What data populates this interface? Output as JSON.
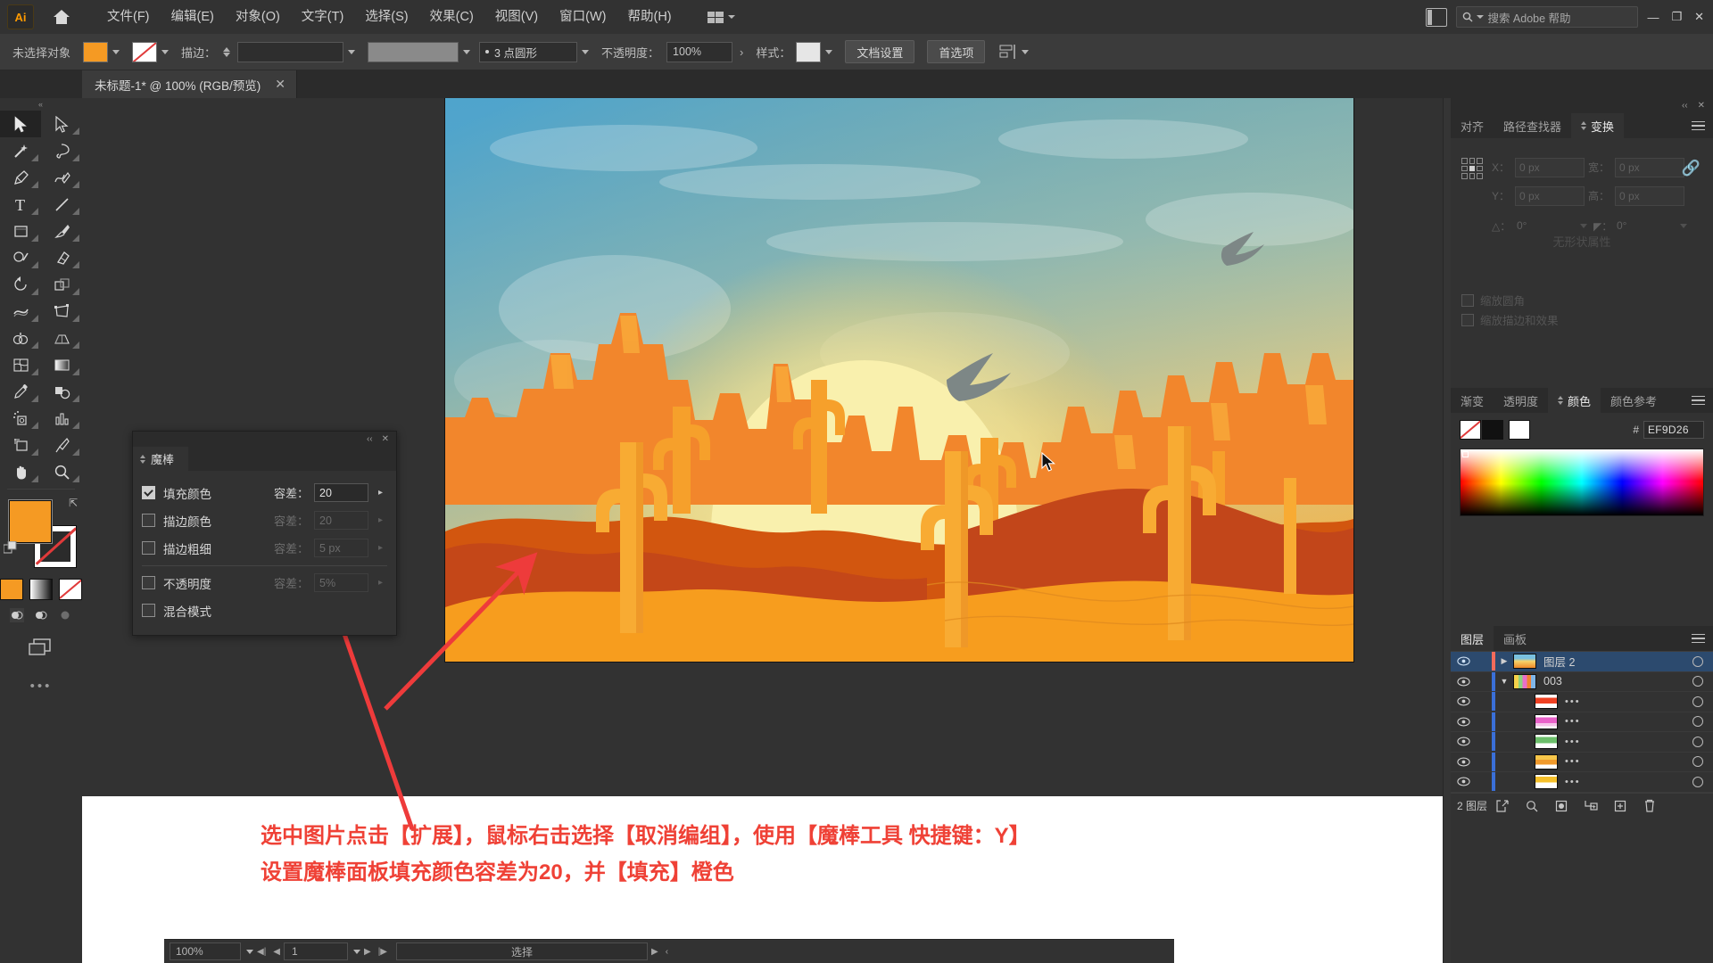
{
  "app": {
    "name": "Adobe Illustrator",
    "logo_text": "Ai",
    "home_icon": "home-icon",
    "search_placeholder": "搜索 Adobe 帮助",
    "search_icon": "search-icon",
    "panel_toggle_icon": "panel-layout-icon",
    "win_minimize": "—",
    "win_restore": "❐",
    "win_close": "✕"
  },
  "menu": {
    "items": [
      {
        "label": "文件(F)"
      },
      {
        "label": "编辑(E)"
      },
      {
        "label": "对象(O)"
      },
      {
        "label": "文字(T)"
      },
      {
        "label": "选择(S)"
      },
      {
        "label": "效果(C)"
      },
      {
        "label": "视图(V)"
      },
      {
        "label": "窗口(W)"
      },
      {
        "label": "帮助(H)"
      }
    ],
    "workspace_switcher": "workspace-switcher"
  },
  "control_bar": {
    "selection_status": "未选择对象",
    "fill_label": "fill-swatch",
    "stroke_label": "stroke-swatch",
    "stroke_text": "描边：",
    "stroke_weight_value": "",
    "brush_value": "",
    "stroke_profile": "3 点圆形",
    "opacity_label": "不透明度：",
    "opacity_value": "100%",
    "style_label": "样式：",
    "doc_setup_button": "文档设置",
    "preferences_button": "首选项",
    "align_icon": "align-icon"
  },
  "document_tab": {
    "title": "未标题-1* @ 100% (RGB/预览)",
    "close_icon": "close-icon"
  },
  "toolbar": {
    "handle": "«",
    "tools": [
      {
        "name": "selection-tool",
        "selected": true
      },
      {
        "name": "direct-selection-tool",
        "selected": false
      },
      {
        "name": "magic-wand-tool",
        "selected": false
      },
      {
        "name": "lasso-tool",
        "selected": false
      },
      {
        "name": "pen-tool",
        "selected": false
      },
      {
        "name": "curvature-tool",
        "selected": false
      },
      {
        "name": "type-tool",
        "selected": false
      },
      {
        "name": "line-segment-tool",
        "selected": false
      },
      {
        "name": "rectangle-tool",
        "selected": false
      },
      {
        "name": "paintbrush-tool",
        "selected": false
      },
      {
        "name": "shaper-tool",
        "selected": false
      },
      {
        "name": "eraser-tool",
        "selected": false
      },
      {
        "name": "rotate-tool",
        "selected": false
      },
      {
        "name": "scale-tool",
        "selected": false
      },
      {
        "name": "width-tool",
        "selected": false
      },
      {
        "name": "free-transform-tool",
        "selected": false
      },
      {
        "name": "shape-builder-tool",
        "selected": false
      },
      {
        "name": "perspective-grid-tool",
        "selected": false
      },
      {
        "name": "mesh-tool",
        "selected": false
      },
      {
        "name": "gradient-tool",
        "selected": false
      },
      {
        "name": "eyedropper-tool",
        "selected": false
      },
      {
        "name": "blend-tool",
        "selected": false
      },
      {
        "name": "symbol-sprayer-tool",
        "selected": false
      },
      {
        "name": "column-graph-tool",
        "selected": false
      },
      {
        "name": "artboard-tool",
        "selected": false
      },
      {
        "name": "slice-tool",
        "selected": false
      },
      {
        "name": "hand-tool",
        "selected": false
      },
      {
        "name": "zoom-tool",
        "selected": false
      }
    ],
    "fill_color": "#F59A23",
    "stroke_color": "none",
    "swap_icon": "swap-fill-stroke-icon",
    "default_icon": "default-fill-stroke-icon",
    "fill_modes": [
      "color-mode",
      "gradient-mode",
      "none-mode"
    ],
    "screen_modes": [
      "draw-normal",
      "draw-behind",
      "draw-inside"
    ],
    "screen_mode_icon": "screen-mode-icon",
    "more_tools": "•••"
  },
  "magic_wand_panel": {
    "title": "魔棒",
    "collapse_icon": "collapse-icon",
    "close_icon": "close-icon",
    "rows": [
      {
        "label": "填充颜色",
        "checked": true,
        "tol_label": "容差：",
        "tol_value": "20",
        "enabled": true
      },
      {
        "label": "描边颜色",
        "checked": false,
        "tol_label": "容差：",
        "tol_value": "20",
        "enabled": false
      },
      {
        "label": "描边粗细",
        "checked": false,
        "tol_label": "容差：",
        "tol_value": "5 px",
        "enabled": false
      },
      {
        "label": "不透明度",
        "checked": false,
        "tol_label": "容差：",
        "tol_value": "5%",
        "enabled": false
      },
      {
        "label": "混合模式",
        "checked": false,
        "tol_label": "",
        "tol_value": "",
        "enabled": false
      }
    ]
  },
  "transform_panel": {
    "tabs": [
      {
        "label": "对齐",
        "active": false
      },
      {
        "label": "路径查找器",
        "active": false
      },
      {
        "label": "变换",
        "active": true
      }
    ],
    "x_label": "X：",
    "x_value": "0 px",
    "y_label": "Y：",
    "y_value": "0 px",
    "w_label": "宽：",
    "w_value": "0 px",
    "h_label": "高：",
    "h_value": "0 px",
    "angle_label": "△：",
    "angle_value": "0°",
    "shear_label": "◤：",
    "shear_value": "0°",
    "link_icon": "link-broken-icon",
    "reference_point": "reference-point-grid",
    "no_properties": "无形状属性",
    "checkbox_scale_corners": "缩放圆角",
    "checkbox_scale_strokes": "缩放描边和效果",
    "menu_icon": "panel-menu-icon"
  },
  "color_panel": {
    "tabs": [
      {
        "label": "渐变",
        "active": false
      },
      {
        "label": "透明度",
        "active": false
      },
      {
        "label": "颜色",
        "active": true
      },
      {
        "label": "颜色参考",
        "active": false
      }
    ],
    "hex_prefix": "#",
    "hex_value": "EF9D26",
    "swatch_none": "none-swatch",
    "swatch_black": "black-swatch",
    "swatch_white": "white-swatch",
    "spectrum": "color-spectrum",
    "menu_icon": "panel-menu-icon"
  },
  "layers_panel": {
    "tabs": [
      {
        "label": "图层",
        "active": true
      },
      {
        "label": "画板",
        "active": false
      }
    ],
    "menu_icon": "panel-menu-icon",
    "rows": [
      {
        "name": "图层 2",
        "selected": true,
        "expanded": false,
        "indent": 0,
        "color": "#f26b5b",
        "thumb": "sunset-thumb",
        "dots": ""
      },
      {
        "name": "003",
        "selected": false,
        "expanded": true,
        "indent": 0,
        "color": "#3a6fd8",
        "thumb": "multi-thumb",
        "dots": ""
      },
      {
        "name": "",
        "selected": false,
        "expanded": null,
        "indent": 1,
        "color": "#3a6fd8",
        "thumb": "red-thumb",
        "dots": "•••"
      },
      {
        "name": "",
        "selected": false,
        "expanded": null,
        "indent": 1,
        "color": "#3a6fd8",
        "thumb": "magenta-thumb",
        "dots": "•••"
      },
      {
        "name": "",
        "selected": false,
        "expanded": null,
        "indent": 1,
        "color": "#3a6fd8",
        "thumb": "green-thumb",
        "dots": "•••"
      },
      {
        "name": "",
        "selected": false,
        "expanded": null,
        "indent": 1,
        "color": "#3a6fd8",
        "thumb": "orange-thumb",
        "dots": "•••"
      },
      {
        "name": "",
        "selected": false,
        "expanded": null,
        "indent": 1,
        "color": "#3a6fd8",
        "thumb": "yellow-thumb",
        "dots": "•••"
      }
    ],
    "footer": {
      "count": "2 图层",
      "icons": [
        "locate-object-icon",
        "search-icon",
        "make-clipping-mask-icon",
        "create-sublayer-icon",
        "create-layer-icon",
        "delete-layer-icon"
      ]
    }
  },
  "status_bar": {
    "zoom": "100%",
    "page": "1",
    "tool_status": "选择",
    "first_icon": "first-page-icon",
    "prev_icon": "prev-page-icon",
    "next_icon": "next-page-icon",
    "last_icon": "last-page-icon"
  },
  "annotation": {
    "line1": "选中图片点击【扩展】，鼠标右击选择【取消编组】，使用【魔棒工具 快捷键：Y】",
    "line2": "设置魔棒面板填充颜色容差为20，并【填充】橙色",
    "color": "#EF4136",
    "arrow_color": "#EE3B3B",
    "arrows": [
      "arrow-to-magic-wand-panel",
      "arrow-to-canvas-fill"
    ]
  },
  "artwork": {
    "description": "desert-sunset-illustration",
    "colors": {
      "sky_top": "#4b9fc9",
      "sky_mid": "#9dc3c6",
      "sun": "#f7efa8",
      "sand": "#f79d1e",
      "dune_dark": "#c2461a",
      "mesa": "#ef7f21",
      "cactus": "#f9a933"
    }
  }
}
